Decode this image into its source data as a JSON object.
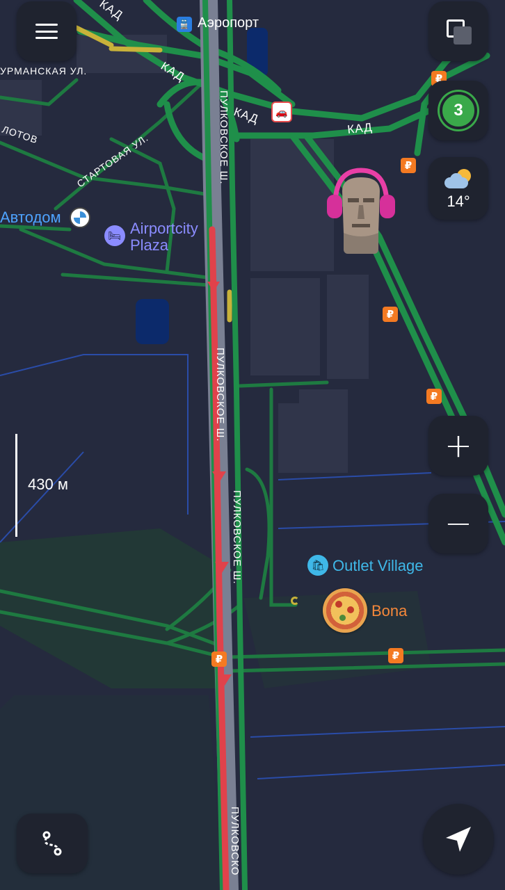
{
  "map": {
    "road_labels": {
      "kad_1": "КАД",
      "kad_2": "КАД",
      "kad_3": "КАД",
      "kad_4": "КАД",
      "murmanskaya": "УРМАНСКАЯ УЛ.",
      "startovaya": "СТАРТОВАЯ УЛ.",
      "lotov": "ЛОТОВ",
      "pulkovskoe_1": "ПУЛКОВСКОЕ Ш.",
      "pulkovskoe_2": "ПУЛКОВСКОЕ Ш.",
      "pulkovskoe_3": "ПУЛКОВСКОЕ Ш.",
      "pulkovskoe_4": "ПУЛКОВСКОЕ Ш.",
      "pulkovskoe_5": "ПУЛКОВСКО"
    },
    "pois": {
      "airport": {
        "label": "Аэропорт",
        "icon": "train-icon",
        "color": "#ffffff"
      },
      "avtodom": {
        "label": "Автодом",
        "icon": "bmw-logo-icon",
        "color": "#4ea3ff"
      },
      "airportcity": {
        "label_line1": "Airportcity",
        "label_line2": "Plaza",
        "icon": "bed-icon",
        "color": "#8b8cff"
      },
      "outlet": {
        "label": "Outlet Village",
        "icon": "shopping-bag-icon",
        "color": "#3fb8e8"
      },
      "bona": {
        "label": "Bona",
        "icon": "pizza-icon",
        "color": "#f5883a"
      }
    },
    "currency_symbol": "₽",
    "scale_label": "430 м"
  },
  "controls": {
    "traffic_level": "3",
    "traffic_color": "#3aa94a",
    "weather_temp": "14°",
    "zoom_in": "+",
    "zoom_out": "−"
  },
  "colors": {
    "road_free": "#1f8f4a",
    "road_jam": "#e0424b",
    "road_slow": "#c8b23a",
    "map_bg": "#252a3e",
    "block": "#2f3447"
  }
}
